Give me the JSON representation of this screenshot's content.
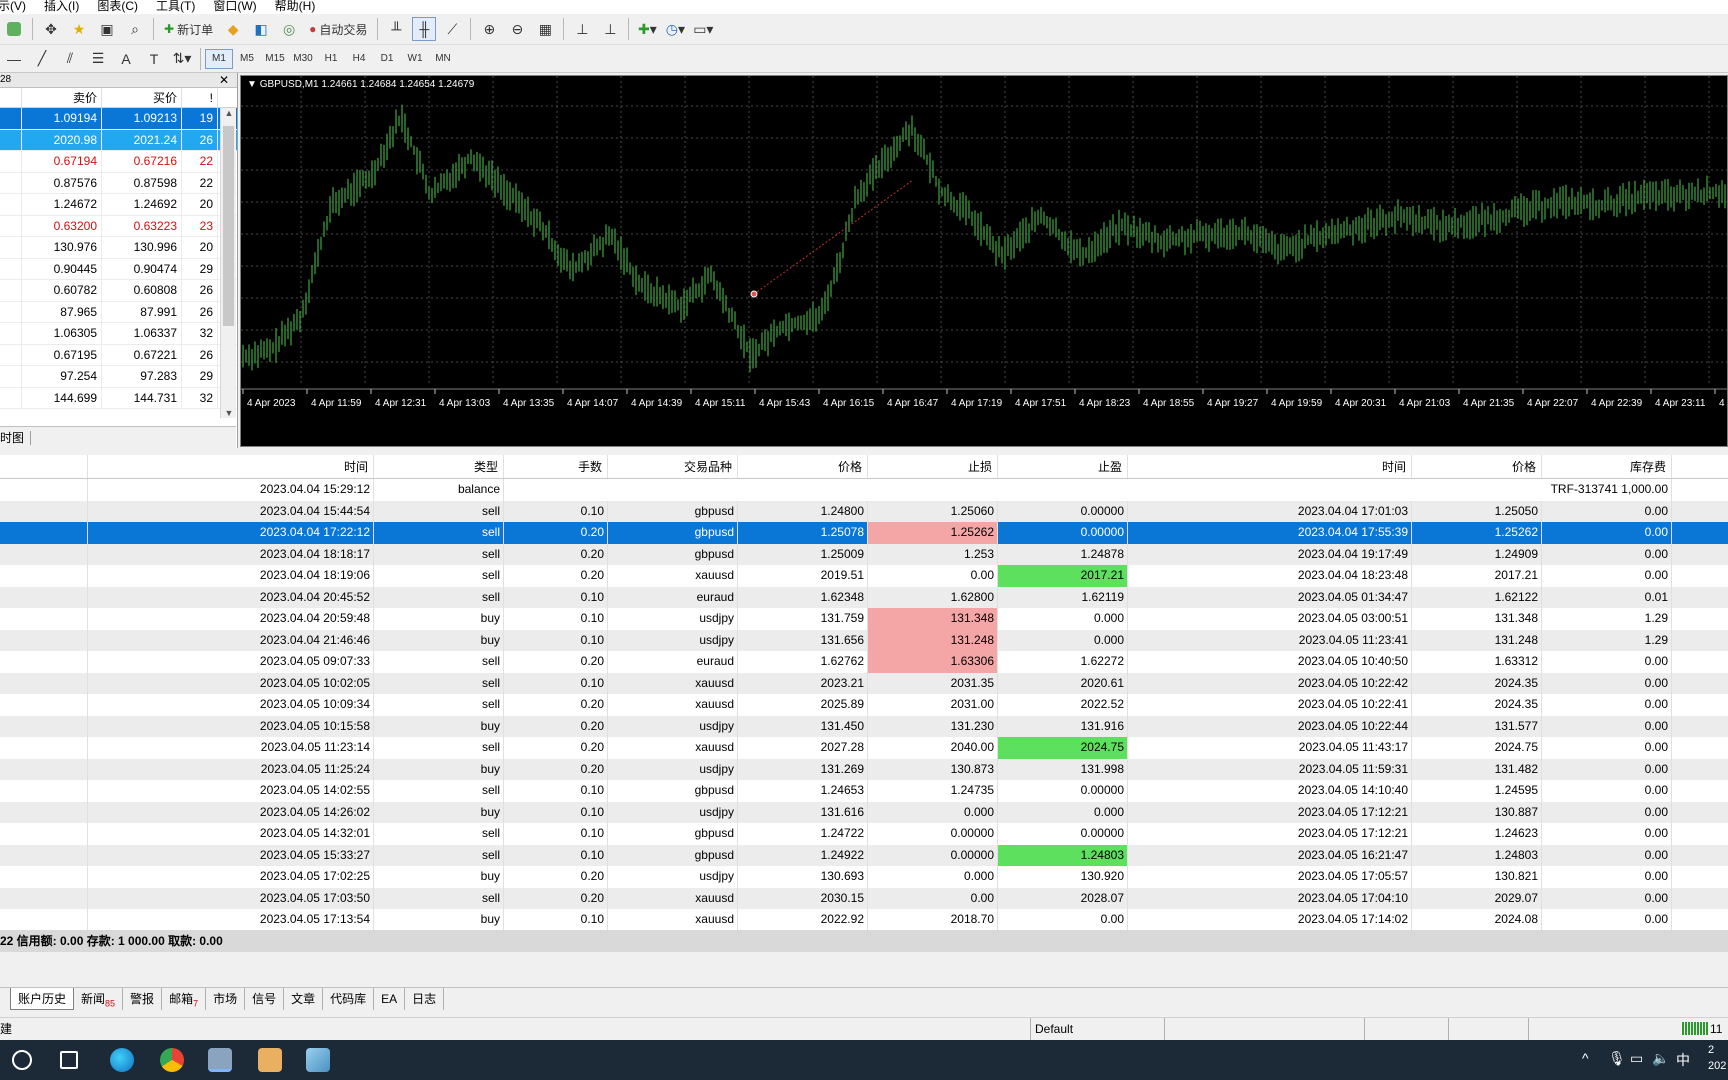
{
  "menu": [
    "示(V)",
    "插入(I)",
    "图表(C)",
    "工具(T)",
    "窗口(W)",
    "帮助(H)"
  ],
  "toolbar1": {
    "new_order": "新订单",
    "auto_trade": "自动交易"
  },
  "timeframes": [
    "M1",
    "M5",
    "M15",
    "M30",
    "H1",
    "H4",
    "D1",
    "W1",
    "MN"
  ],
  "market_watch": {
    "title": "28",
    "headers": {
      "bid": "卖价",
      "ask": "买价",
      "spread": "!"
    },
    "rows": [
      {
        "bid": "1.09194",
        "ask": "1.09213",
        "spread": "19"
      },
      {
        "bid": "2020.98",
        "ask": "2021.24",
        "spread": "26"
      },
      {
        "bid": "0.67194",
        "ask": "0.67216",
        "spread": "22"
      },
      {
        "bid": "0.87576",
        "ask": "0.87598",
        "spread": "22"
      },
      {
        "bid": "1.24672",
        "ask": "1.24692",
        "spread": "20"
      },
      {
        "bid": "0.63200",
        "ask": "0.63223",
        "spread": "23"
      },
      {
        "bid": "130.976",
        "ask": "130.996",
        "spread": "20"
      },
      {
        "bid": "0.90445",
        "ask": "0.90474",
        "spread": "29"
      },
      {
        "bid": "0.60782",
        "ask": "0.60808",
        "spread": "26"
      },
      {
        "bid": "87.965",
        "ask": "87.991",
        "spread": "26"
      },
      {
        "bid": "1.06305",
        "ask": "1.06337",
        "spread": "32"
      },
      {
        "bid": "0.67195",
        "ask": "0.67221",
        "spread": "26"
      },
      {
        "bid": "97.254",
        "ask": "97.283",
        "spread": "29"
      },
      {
        "bid": "144.699",
        "ask": "144.731",
        "spread": "32"
      }
    ],
    "tab": "时图"
  },
  "chart": {
    "title": "GBPUSD,M1  1.24661 1.24684 1.24654 1.24679",
    "time_labels": [
      "4 Apr 2023",
      "4 Apr 11:59",
      "4 Apr 12:31",
      "4 Apr 13:03",
      "4 Apr 13:35",
      "4 Apr 14:07",
      "4 Apr 14:39",
      "4 Apr 15:11",
      "4 Apr 15:43",
      "4 Apr 16:15",
      "4 Apr 16:47",
      "4 Apr 17:19",
      "4 Apr 17:51",
      "4 Apr 18:23",
      "4 Apr 18:55",
      "4 Apr 19:27",
      "4 Apr 19:59",
      "4 Apr 20:31",
      "4 Apr 21:03",
      "4 Apr 21:35",
      "4 Apr 22:07",
      "4 Apr 22:39",
      "4 Apr 23:11",
      "4 A"
    ]
  },
  "history": {
    "headers": [
      "时间",
      "类型",
      "手数",
      "交易品种",
      "价格",
      "止损",
      "止盈",
      "时间",
      "价格",
      "库存费"
    ],
    "balance_row": {
      "time": "2023.04.04 15:29:12",
      "type": "balance",
      "comment": "TRF-313741 1,000.00"
    },
    "rows": [
      {
        "open_time": "2023.04.04 15:44:54",
        "type": "sell",
        "lots": "0.10",
        "symbol": "gbpusd",
        "price": "1.24800",
        "sl": "1.25060",
        "tp": "0.00000",
        "close_time": "2023.04.04 17:01:03",
        "close_price": "1.25050",
        "swap": "0.00",
        "sl_hl": "",
        "tp_hl": ""
      },
      {
        "open_time": "2023.04.04 17:22:12",
        "type": "sell",
        "lots": "0.20",
        "symbol": "gbpusd",
        "price": "1.25078",
        "sl": "1.25262",
        "tp": "0.00000",
        "close_time": "2023.04.04 17:55:39",
        "close_price": "1.25262",
        "swap": "0.00",
        "sl_hl": "pink",
        "tp_hl": ""
      },
      {
        "open_time": "2023.04.04 18:18:17",
        "type": "sell",
        "lots": "0.20",
        "symbol": "gbpusd",
        "price": "1.25009",
        "sl": "1.253",
        "tp": "1.24878",
        "close_time": "2023.04.04 19:17:49",
        "close_price": "1.24909",
        "swap": "0.00",
        "sl_hl": "",
        "tp_hl": ""
      },
      {
        "open_time": "2023.04.04 18:19:06",
        "type": "sell",
        "lots": "0.20",
        "symbol": "xauusd",
        "price": "2019.51",
        "sl": "0.00",
        "tp": "2017.21",
        "close_time": "2023.04.04 18:23:48",
        "close_price": "2017.21",
        "swap": "0.00",
        "sl_hl": "",
        "tp_hl": "green"
      },
      {
        "open_time": "2023.04.04 20:45:52",
        "type": "sell",
        "lots": "0.10",
        "symbol": "euraud",
        "price": "1.62348",
        "sl": "1.62800",
        "tp": "1.62119",
        "close_time": "2023.04.05 01:34:47",
        "close_price": "1.62122",
        "swap": "0.01",
        "sl_hl": "",
        "tp_hl": ""
      },
      {
        "open_time": "2023.04.04 20:59:48",
        "type": "buy",
        "lots": "0.10",
        "symbol": "usdjpy",
        "price": "131.759",
        "sl": "131.348",
        "tp": "0.000",
        "close_time": "2023.04.05 03:00:51",
        "close_price": "131.348",
        "swap": "1.29",
        "sl_hl": "pink",
        "tp_hl": ""
      },
      {
        "open_time": "2023.04.04 21:46:46",
        "type": "buy",
        "lots": "0.10",
        "symbol": "usdjpy",
        "price": "131.656",
        "sl": "131.248",
        "tp": "0.000",
        "close_time": "2023.04.05 11:23:41",
        "close_price": "131.248",
        "swap": "1.29",
        "sl_hl": "pink",
        "tp_hl": ""
      },
      {
        "open_time": "2023.04.05 09:07:33",
        "type": "sell",
        "lots": "0.20",
        "symbol": "euraud",
        "price": "1.62762",
        "sl": "1.63306",
        "tp": "1.62272",
        "close_time": "2023.04.05 10:40:50",
        "close_price": "1.63312",
        "swap": "0.00",
        "sl_hl": "pink",
        "tp_hl": ""
      },
      {
        "open_time": "2023.04.05 10:02:05",
        "type": "sell",
        "lots": "0.10",
        "symbol": "xauusd",
        "price": "2023.21",
        "sl": "2031.35",
        "tp": "2020.61",
        "close_time": "2023.04.05 10:22:42",
        "close_price": "2024.35",
        "swap": "0.00",
        "sl_hl": "",
        "tp_hl": ""
      },
      {
        "open_time": "2023.04.05 10:09:34",
        "type": "sell",
        "lots": "0.20",
        "symbol": "xauusd",
        "price": "2025.89",
        "sl": "2031.00",
        "tp": "2022.52",
        "close_time": "2023.04.05 10:22:41",
        "close_price": "2024.35",
        "swap": "0.00",
        "sl_hl": "",
        "tp_hl": ""
      },
      {
        "open_time": "2023.04.05 10:15:58",
        "type": "buy",
        "lots": "0.20",
        "symbol": "usdjpy",
        "price": "131.450",
        "sl": "131.230",
        "tp": "131.916",
        "close_time": "2023.04.05 10:22:44",
        "close_price": "131.577",
        "swap": "0.00",
        "sl_hl": "",
        "tp_hl": ""
      },
      {
        "open_time": "2023.04.05 11:23:14",
        "type": "sell",
        "lots": "0.20",
        "symbol": "xauusd",
        "price": "2027.28",
        "sl": "2040.00",
        "tp": "2024.75",
        "close_time": "2023.04.05 11:43:17",
        "close_price": "2024.75",
        "swap": "0.00",
        "sl_hl": "",
        "tp_hl": "green"
      },
      {
        "open_time": "2023.04.05 11:25:24",
        "type": "buy",
        "lots": "0.20",
        "symbol": "usdjpy",
        "price": "131.269",
        "sl": "130.873",
        "tp": "131.998",
        "close_time": "2023.04.05 11:59:31",
        "close_price": "131.482",
        "swap": "0.00",
        "sl_hl": "",
        "tp_hl": ""
      },
      {
        "open_time": "2023.04.05 14:02:55",
        "type": "sell",
        "lots": "0.10",
        "symbol": "gbpusd",
        "price": "1.24653",
        "sl": "1.24735",
        "tp": "0.00000",
        "close_time": "2023.04.05 14:10:40",
        "close_price": "1.24595",
        "swap": "0.00",
        "sl_hl": "",
        "tp_hl": ""
      },
      {
        "open_time": "2023.04.05 14:26:02",
        "type": "buy",
        "lots": "0.10",
        "symbol": "usdjpy",
        "price": "131.616",
        "sl": "0.000",
        "tp": "0.000",
        "close_time": "2023.04.05 17:12:21",
        "close_price": "130.887",
        "swap": "0.00",
        "sl_hl": "",
        "tp_hl": ""
      },
      {
        "open_time": "2023.04.05 14:32:01",
        "type": "sell",
        "lots": "0.10",
        "symbol": "gbpusd",
        "price": "1.24722",
        "sl": "0.00000",
        "tp": "0.00000",
        "close_time": "2023.04.05 17:12:21",
        "close_price": "1.24623",
        "swap": "0.00",
        "sl_hl": "",
        "tp_hl": ""
      },
      {
        "open_time": "2023.04.05 15:33:27",
        "type": "sell",
        "lots": "0.10",
        "symbol": "gbpusd",
        "price": "1.24922",
        "sl": "0.00000",
        "tp": "1.24803",
        "close_time": "2023.04.05 16:21:47",
        "close_price": "1.24803",
        "swap": "0.00",
        "sl_hl": "",
        "tp_hl": "green"
      },
      {
        "open_time": "2023.04.05 17:02:25",
        "type": "buy",
        "lots": "0.20",
        "symbol": "usdjpy",
        "price": "130.693",
        "sl": "0.000",
        "tp": "130.920",
        "close_time": "2023.04.05 17:05:57",
        "close_price": "130.821",
        "swap": "0.00",
        "sl_hl": "",
        "tp_hl": ""
      },
      {
        "open_time": "2023.04.05 17:03:50",
        "type": "sell",
        "lots": "0.20",
        "symbol": "xauusd",
        "price": "2030.15",
        "sl": "0.00",
        "tp": "2028.07",
        "close_time": "2023.04.05 17:04:10",
        "close_price": "2029.07",
        "swap": "0.00",
        "sl_hl": "",
        "tp_hl": ""
      },
      {
        "open_time": "2023.04.05 17:13:54",
        "type": "buy",
        "lots": "0.10",
        "symbol": "xauusd",
        "price": "2022.92",
        "sl": "2018.70",
        "tp": "0.00",
        "close_time": "2023.04.05 17:14:02",
        "close_price": "2024.08",
        "swap": "0.00",
        "sl_hl": "",
        "tp_hl": ""
      }
    ],
    "selected_row": 1,
    "summary": "22  信用额: 0.00  存款: 1 000.00  取款: 0.00"
  },
  "bottom_tabs": [
    {
      "label": "账户历史",
      "badge": ""
    },
    {
      "label": "新闻",
      "badge": "85"
    },
    {
      "label": "警报",
      "badge": ""
    },
    {
      "label": "邮箱",
      "badge": "7"
    },
    {
      "label": "市场",
      "badge": ""
    },
    {
      "label": "信号",
      "badge": ""
    },
    {
      "label": "文章",
      "badge": ""
    },
    {
      "label": "代码库",
      "badge": ""
    },
    {
      "label": "EA",
      "badge": ""
    },
    {
      "label": "日志",
      "badge": ""
    }
  ],
  "statusbar": {
    "left": "建",
    "profile": "Default",
    "right": "11"
  },
  "taskbar": {
    "clock_top": "2",
    "clock_bottom": "202",
    "ime": "中"
  }
}
